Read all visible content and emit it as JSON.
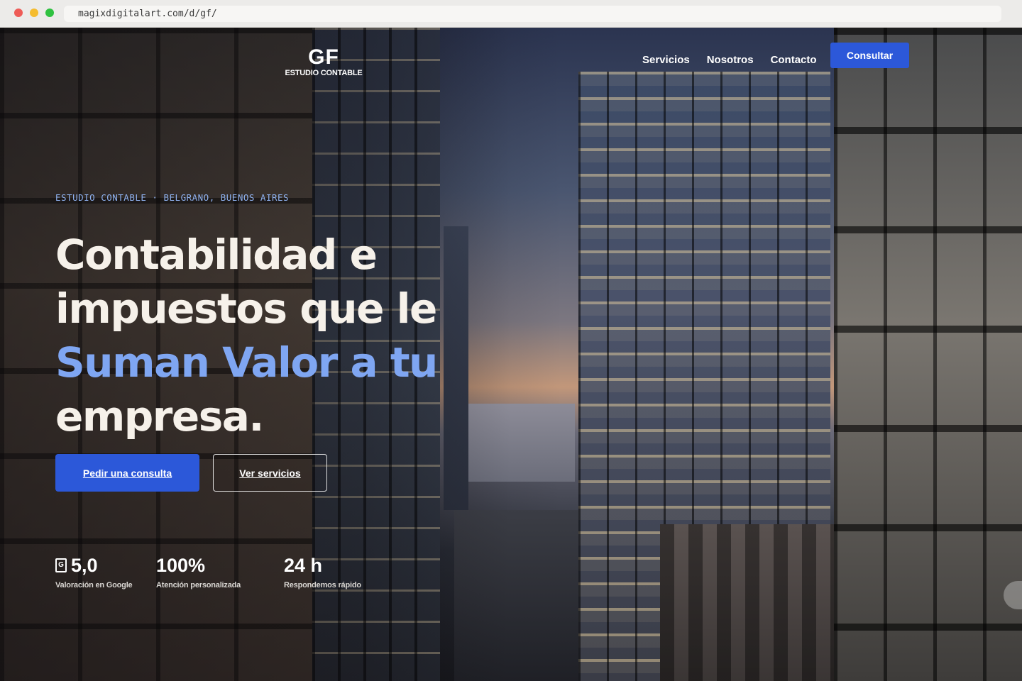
{
  "browser": {
    "url": "magixdigitalart.com/d/gf/"
  },
  "nav": {
    "logo_mark": "GF",
    "logo_sub": "ESTUDIO CONTABLE",
    "links": [
      "Servicios",
      "Nosotros",
      "Contacto"
    ],
    "cta": "Consultar"
  },
  "hero": {
    "eyebrow": "ESTUDIO CONTABLE · BELGRANO, BUENOS AIRES",
    "headline_line1": "Contabilidad e",
    "headline_line2": "impuestos que le",
    "headline_accent": "Suman Valor a tu",
    "headline_line4": "empresa.",
    "primary_button": "Pedir una consulta",
    "secondary_button": "Ver servicios"
  },
  "stats": [
    {
      "icon": "google-icon",
      "value": "5,0",
      "label": "Valoración en Google"
    },
    {
      "value": "100%",
      "label": "Atención personalizada"
    },
    {
      "value": "24 h",
      "label": "Respondemos rápido"
    }
  ],
  "colors": {
    "accent": "#2c58d9",
    "accent_text": "#7fa6f2",
    "eyebrow": "#8fb2f0"
  }
}
